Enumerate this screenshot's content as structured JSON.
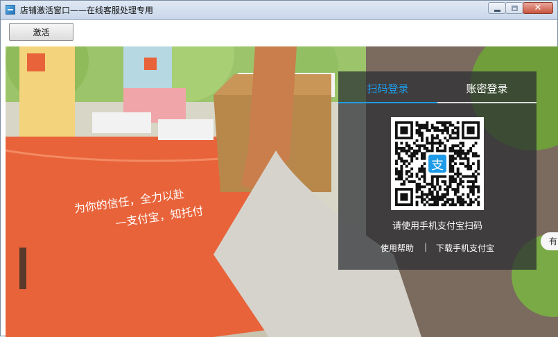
{
  "window": {
    "title": "店铺激活窗口——在线客服处理专用",
    "icon": "app-window-icon",
    "controls": {
      "minimize": "minimize-icon",
      "maximize": "maximize-icon",
      "close": "✕"
    }
  },
  "toolbar": {
    "activate_label": "激活"
  },
  "illustration": {
    "banner_line1": "为你的信任，全力以赴",
    "banner_line2": "—支付宝，知托付"
  },
  "login": {
    "tabs": [
      {
        "label": "扫码登录",
        "active": true
      },
      {
        "label": "账密登录",
        "active": false
      }
    ],
    "qr_caption": "请使用手机支付宝扫码",
    "help_link": "使用帮助",
    "separator": "|",
    "download_link": "下载手机支付宝",
    "accent_color": "#1e9be8",
    "alipay_logo_glyph": "支"
  },
  "side_tab": {
    "label": "有"
  }
}
